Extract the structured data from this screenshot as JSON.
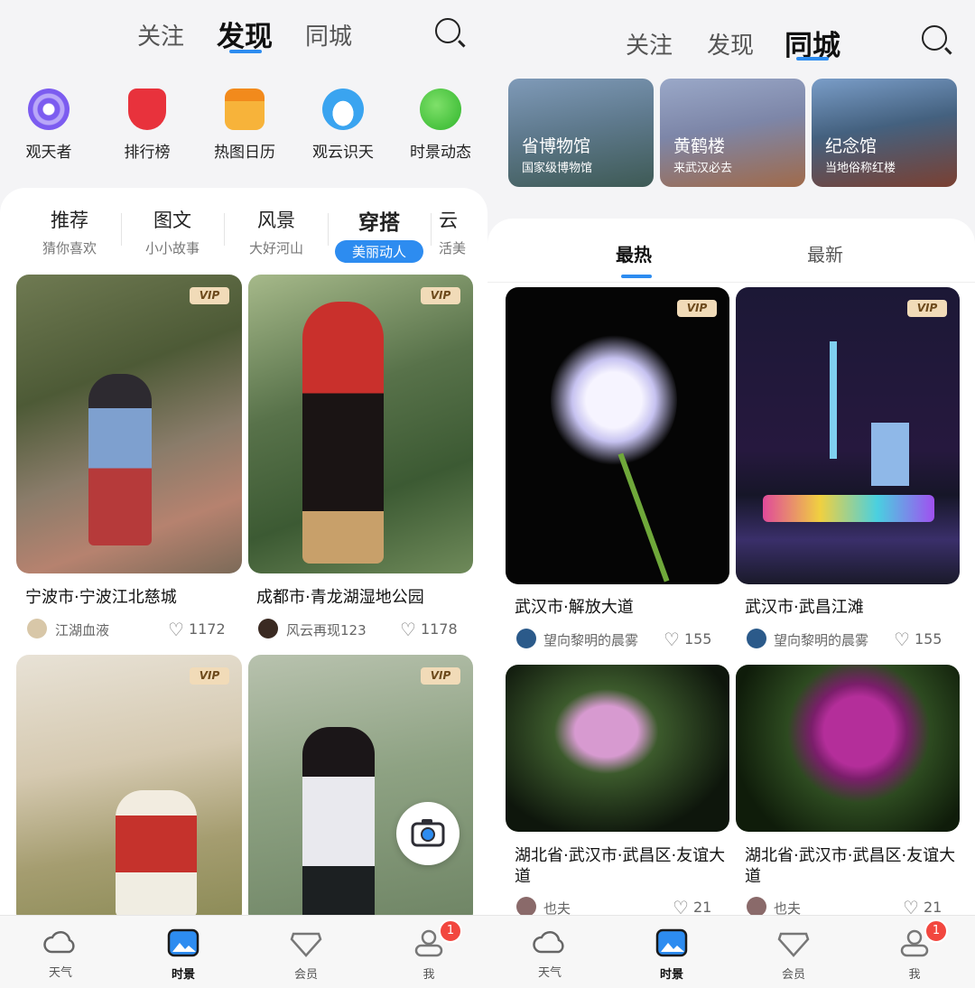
{
  "left": {
    "top_tabs": [
      "关注",
      "发现",
      "同城"
    ],
    "quick_links": [
      {
        "label": "观天者",
        "icon": "eye-icon",
        "color": "#7c5cf0"
      },
      {
        "label": "排行榜",
        "icon": "trophy-icon",
        "color": "#e8323c"
      },
      {
        "label": "热图日历",
        "icon": "calendar-icon",
        "color": "#f7a823"
      },
      {
        "label": "观云识天",
        "icon": "cloud-icon",
        "color": "#3aa4f0"
      },
      {
        "label": "时景动态",
        "icon": "planet-icon",
        "color": "#3fc83a"
      }
    ],
    "categories": [
      {
        "title": "推荐",
        "sub": "猜你喜欢"
      },
      {
        "title": "图文",
        "sub": "小小故事"
      },
      {
        "title": "风景",
        "sub": "大好河山"
      },
      {
        "title": "穿搭",
        "sub": "美丽动人"
      },
      {
        "title": "云",
        "sub": "活美"
      }
    ],
    "cards": [
      {
        "vip": "VIP",
        "title": "宁波市·宁波江北慈城",
        "author": "江湖血液",
        "likes": "1172"
      },
      {
        "vip": "VIP",
        "title": "成都市·青龙湖湿地公园",
        "author": "风云再现123",
        "likes": "1178"
      },
      {
        "vip": "VIP"
      },
      {
        "vip": "VIP"
      }
    ]
  },
  "right": {
    "top_tabs": [
      "关注",
      "发现",
      "同城"
    ],
    "cities": [
      {
        "name": "省博物馆",
        "desc": "国家级博物馆"
      },
      {
        "name": "黄鹤楼",
        "desc": "来武汉必去"
      },
      {
        "name": "纪念馆",
        "desc": "当地俗称红楼"
      }
    ],
    "sort_tabs": [
      "最热",
      "最新"
    ],
    "cards": [
      {
        "vip": "VIP",
        "title": "武汉市·解放大道",
        "author": "望向黎明的晨雾",
        "likes": "155"
      },
      {
        "vip": "VIP",
        "title": "武汉市·武昌江滩",
        "author": "望向黎明的晨雾",
        "likes": "155"
      },
      {
        "title": "湖北省·武汉市·武昌区·友谊大道",
        "author": "也夫",
        "likes": "21"
      },
      {
        "title": "湖北省·武汉市·武昌区·友谊大道",
        "author": "也夫",
        "likes": "21"
      }
    ]
  },
  "bottom_nav": [
    {
      "label": "天气",
      "icon": "cloud-icon"
    },
    {
      "label": "时景",
      "icon": "image-icon"
    },
    {
      "label": "会员",
      "icon": "vip-icon"
    },
    {
      "label": "我",
      "icon": "user-icon",
      "badge": "1"
    }
  ],
  "colors": {
    "accent": "#2d8cf0",
    "badge": "#f2473f",
    "vip_bg": "#f1dbb8"
  }
}
